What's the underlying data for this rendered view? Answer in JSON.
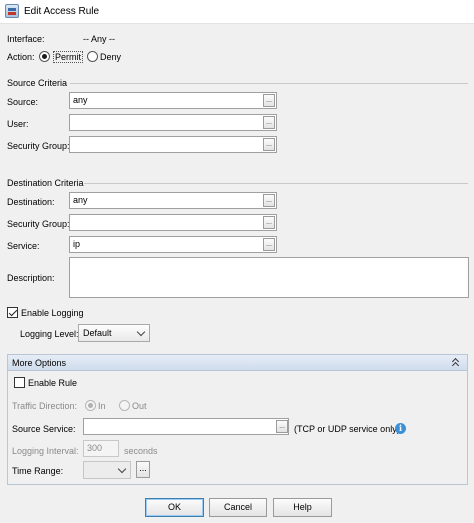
{
  "window": {
    "title": "Edit Access Rule"
  },
  "interface": {
    "label": "Interface:",
    "value": "-- Any --"
  },
  "action": {
    "label": "Action:",
    "permit": "Permit",
    "deny": "Deny",
    "selected": "permit"
  },
  "source": {
    "section_title": "Source Criteria",
    "source_label": "Source:",
    "source_value": "any",
    "user_label": "User:",
    "user_value": "",
    "group_label": "Security Group:",
    "group_value": ""
  },
  "destination": {
    "section_title": "Destination Criteria",
    "destination_label": "Destination:",
    "destination_value": "any",
    "group_label": "Security Group:",
    "group_value": "",
    "service_label": "Service:",
    "service_value": "ip"
  },
  "description": {
    "label": "Description:",
    "value": ""
  },
  "logging": {
    "enable_label": "Enable Logging",
    "enabled": true,
    "level_label": "Logging Level:",
    "level_value": "Default"
  },
  "more_options": {
    "title": "More Options",
    "enable_rule_label": "Enable Rule",
    "enable_rule_checked": false,
    "traffic_direction_label": "Traffic Direction:",
    "in_label": "In",
    "out_label": "Out",
    "source_service_label": "Source Service:",
    "source_service_value": "",
    "source_service_hint": "(TCP or UDP service only)",
    "logging_interval_label": "Logging Interval:",
    "logging_interval_value": "300",
    "logging_interval_unit": "seconds",
    "time_range_label": "Time Range:",
    "time_range_value": ""
  },
  "browse_label": "...",
  "buttons": {
    "ok": "OK",
    "cancel": "Cancel",
    "help": "Help"
  },
  "icons": {
    "info": "i"
  }
}
